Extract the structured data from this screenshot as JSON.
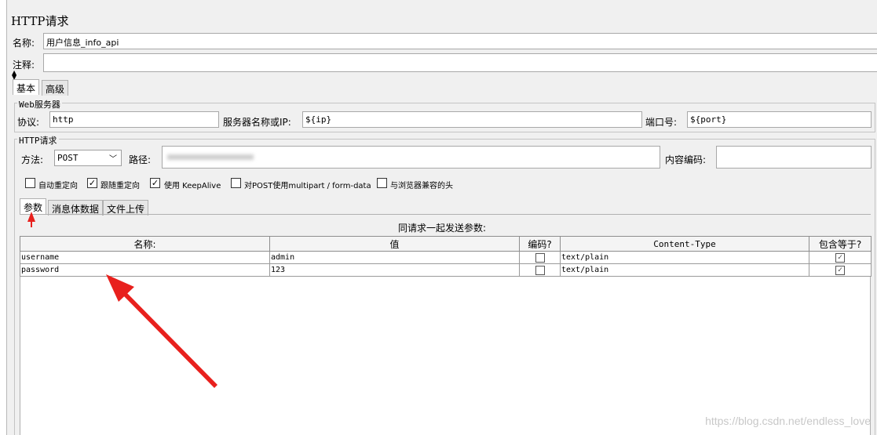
{
  "header": {
    "title": "HTTP请求"
  },
  "name_row": {
    "label": "名称:",
    "value": "用户信息_info_api"
  },
  "comment_row": {
    "label": "注释:",
    "value": ""
  },
  "top_tabs": [
    {
      "label": "基本"
    },
    {
      "label": "高级"
    }
  ],
  "web_server": {
    "group_title": "Web服务器",
    "protocol_label": "协议:",
    "protocol_value": "http",
    "server_label": "服务器名称或IP:",
    "server_value": "${ip}",
    "port_label": "端口号:",
    "port_value": "${port}"
  },
  "http_request": {
    "group_title": "HTTP请求",
    "method_label": "方法:",
    "method_value": "POST",
    "path_label": "路径:",
    "encoding_label": "内容编码:",
    "encoding_value": ""
  },
  "options": [
    {
      "label": "自动重定向",
      "checked": false
    },
    {
      "label": "跟随重定向",
      "checked": true
    },
    {
      "label": "使用 KeepAlive",
      "checked": true
    },
    {
      "label": "对POST使用multipart / form-data",
      "checked": false
    },
    {
      "label": "与浏览器兼容的头",
      "checked": false
    }
  ],
  "sub_tabs": [
    {
      "label": "参数"
    },
    {
      "label": "消息体数据"
    },
    {
      "label": "文件上传"
    }
  ],
  "params": {
    "caption": "同请求一起发送参数:",
    "columns": [
      "名称:",
      "值",
      "编码?",
      "Content-Type",
      "包含等于?"
    ],
    "rows": [
      {
        "name": "username",
        "value": "admin",
        "encode": false,
        "content_type": "text/plain",
        "include_equals": true
      },
      {
        "name": "password",
        "value": "123",
        "encode": false,
        "content_type": "text/plain",
        "include_equals": true
      }
    ]
  },
  "watermark": "https://blog.csdn.net/endless_love",
  "colors": {
    "annotation_arrow": "#e8201d",
    "panel_bg": "#f0f0f0"
  }
}
